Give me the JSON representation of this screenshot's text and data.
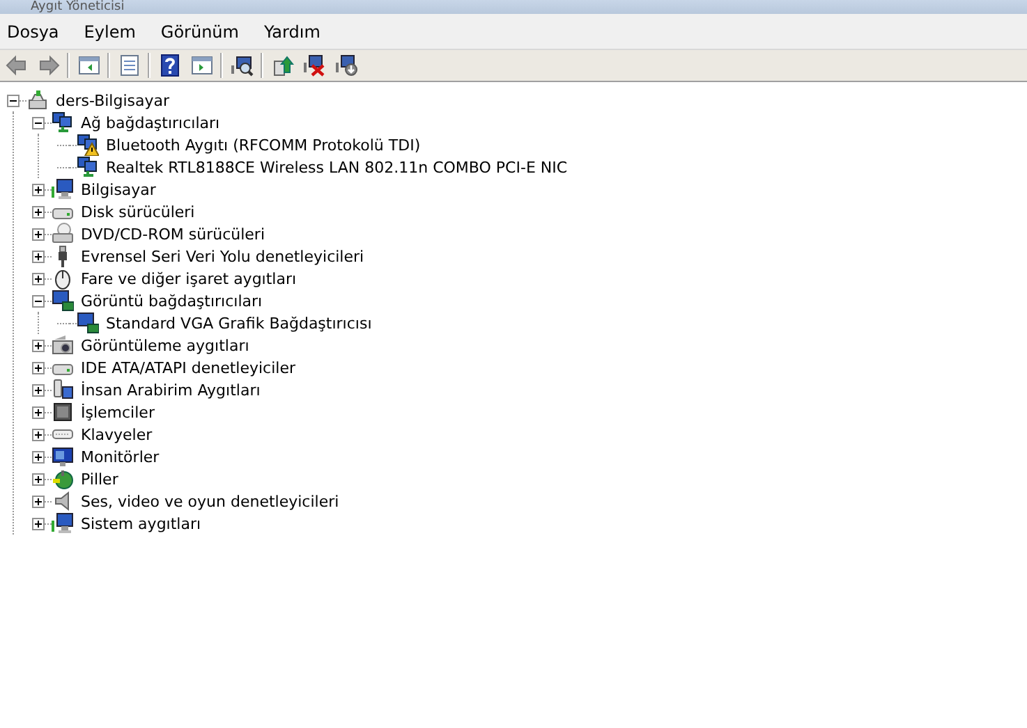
{
  "window": {
    "title": "Aygıt Yöneticisi"
  },
  "menu": [
    "Dosya",
    "Eylem",
    "Görünüm",
    "Yardım"
  ],
  "tree": [
    {
      "label": "ders-Bilgisayar",
      "kind": "computer",
      "expanded": true,
      "children": [
        {
          "label": "Ağ bağdaştırıcıları",
          "kind": "network",
          "expanded": true,
          "children": [
            {
              "label": "Bluetooth Aygıtı (RFCOMM Protokolü TDI)",
              "kind": "network-warning"
            },
            {
              "label": "Realtek RTL8188CE Wireless LAN 802.11n COMBO PCI-E NIC",
              "kind": "network"
            }
          ]
        },
        {
          "label": "Bilgisayar",
          "kind": "monitor",
          "expanded": false
        },
        {
          "label": "Disk sürücüleri",
          "kind": "drive",
          "expanded": false
        },
        {
          "label": "DVD/CD-ROM sürücüleri",
          "kind": "disc",
          "expanded": false
        },
        {
          "label": "Evrensel Seri Veri Yolu denetleyicileri",
          "kind": "plug",
          "expanded": false
        },
        {
          "label": "Fare ve diğer işaret aygıtları",
          "kind": "mouse",
          "expanded": false
        },
        {
          "label": "Görüntü bağdaştırıcıları",
          "kind": "display",
          "expanded": true,
          "children": [
            {
              "label": "Standard VGA Grafik Bağdaştırıcısı",
              "kind": "display"
            }
          ]
        },
        {
          "label": "Görüntüleme aygıtları",
          "kind": "camera",
          "expanded": false
        },
        {
          "label": "IDE ATA/ATAPI denetleyiciler",
          "kind": "drive",
          "expanded": false
        },
        {
          "label": "İnsan Arabirim Aygıtları",
          "kind": "hid",
          "expanded": false
        },
        {
          "label": "İşlemciler",
          "kind": "chip",
          "expanded": false
        },
        {
          "label": "Klavyeler",
          "kind": "keyboard",
          "expanded": false
        },
        {
          "label": "Monitörler",
          "kind": "screen",
          "expanded": false
        },
        {
          "label": "Piller",
          "kind": "battery",
          "expanded": false
        },
        {
          "label": "Ses, video ve oyun denetleyicileri",
          "kind": "speaker",
          "expanded": false
        },
        {
          "label": "Sistem aygıtları",
          "kind": "monitor",
          "expanded": false
        }
      ]
    }
  ]
}
